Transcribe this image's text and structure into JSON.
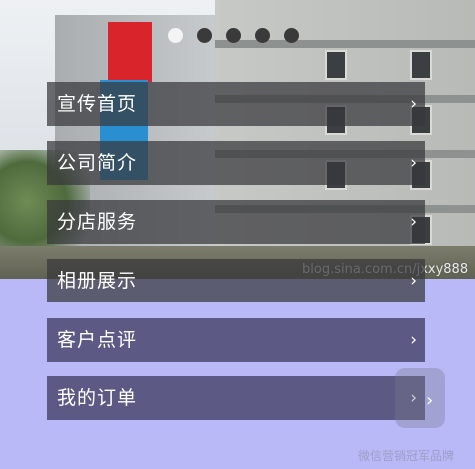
{
  "hero": {
    "watermark": "blog.sina.com.cn/jxxy888"
  },
  "slider": {
    "dot_count": 5,
    "active_index": 0
  },
  "menu": {
    "items": [
      {
        "label": "宣传首页"
      },
      {
        "label": "公司简介"
      },
      {
        "label": "分店服务"
      },
      {
        "label": "相册展示"
      },
      {
        "label": "客户点评"
      },
      {
        "label": "我的订单"
      }
    ],
    "chevron": "›"
  },
  "footer": {
    "watermark_text": "微信营销冠军品牌"
  },
  "colors": {
    "page_background": "#b9b9f7",
    "menu_item_overlay": "#37373c",
    "menu_item_solid": "#5c5a84"
  }
}
